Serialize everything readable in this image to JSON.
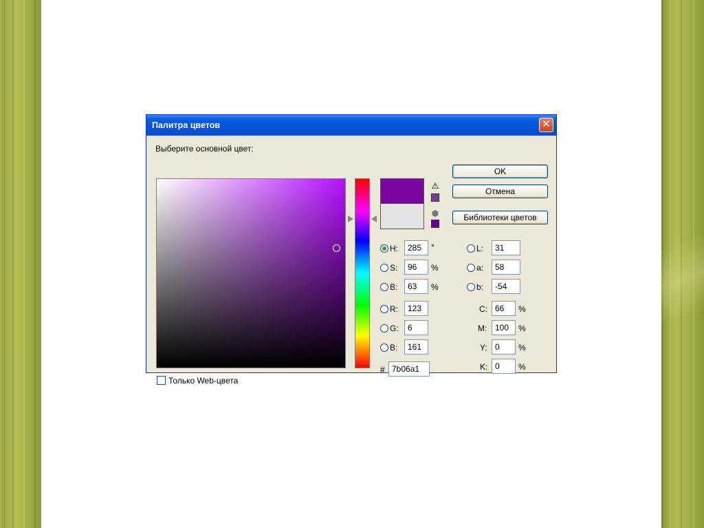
{
  "dialog": {
    "title": "Палитра цветов",
    "close_glyph": "✕",
    "prompt": "Выберите основной цвет:",
    "new_color": "#7b06a1",
    "current_color": "#e4e4e4",
    "gamut_warning_glyph": "⚠",
    "gamut_swatch_color": "#7a3a9a",
    "web_safe_glyph": "⬢",
    "web_safe_swatch_color": "#660099",
    "buttons": {
      "ok": "OK",
      "cancel": "Отмена",
      "libraries": "Библиотеки цветов"
    },
    "hsb": {
      "h_label": "H:",
      "h_value": "285",
      "h_unit": "°",
      "s_label": "S:",
      "s_value": "96",
      "s_unit": "%",
      "b_label": "B:",
      "b_value": "63",
      "b_unit": "%"
    },
    "rgb": {
      "r_label": "R:",
      "r_value": "123",
      "g_label": "G:",
      "g_value": "6",
      "b_label": "B:",
      "b_value": "161"
    },
    "hex": {
      "label": "#",
      "value": "7b06a1"
    },
    "lab": {
      "l_label": "L:",
      "l_value": "31",
      "a_label": "a:",
      "a_value": "58",
      "b_label": "b:",
      "b_value": "-54"
    },
    "cmyk": {
      "c_label": "C:",
      "c_value": "66",
      "c_unit": "%",
      "m_label": "M:",
      "m_value": "100",
      "m_unit": "%",
      "y_label": "Y:",
      "y_value": "0",
      "y_unit": "%",
      "k_label": "K:",
      "k_value": "0",
      "k_unit": "%"
    },
    "web_only_label": "Только Web-цвета"
  }
}
